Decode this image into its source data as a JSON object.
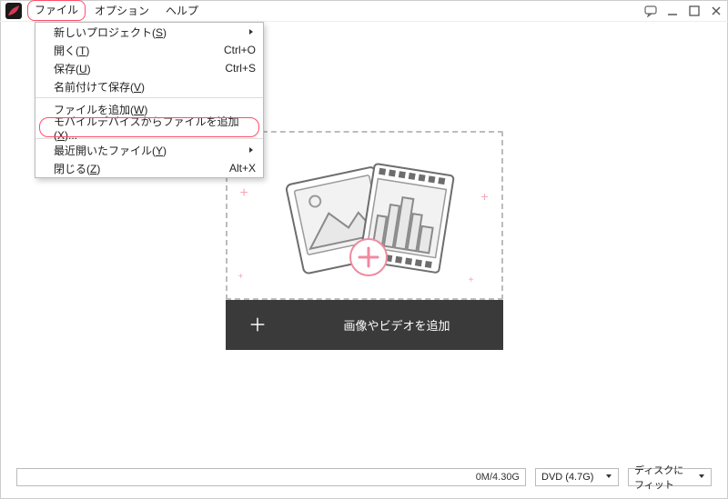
{
  "menu": {
    "file": "ファイル",
    "options": "オプション",
    "help": "ヘルプ"
  },
  "dropdown": {
    "new_project": {
      "label_pre": "新しいプロジェクト(",
      "accel": "S",
      "label_post": ")"
    },
    "open": {
      "label_pre": "開く(",
      "accel": "T",
      "label_post": ")",
      "shortcut": "Ctrl+O"
    },
    "save": {
      "label_pre": "保存(",
      "accel": "U",
      "label_post": ")",
      "shortcut": "Ctrl+S"
    },
    "save_as": {
      "label_pre": "名前付けて保存(",
      "accel": "V",
      "label_post": ")"
    },
    "add_file": {
      "label_pre": "ファイルを追加(",
      "accel": "W",
      "label_post": ")"
    },
    "add_mobile": {
      "label_pre": "モバイルデバイスからファイルを追加(",
      "accel": "X",
      "label_post": ")..."
    },
    "recent": {
      "label_pre": "最近開いたファイル(",
      "accel": "Y",
      "label_post": ")"
    },
    "close": {
      "label_pre": "閉じる(",
      "accel": "Z",
      "label_post": ")",
      "shortcut": "Alt+X"
    }
  },
  "dropzone": {
    "add_media_label": "画像やビデオを追加"
  },
  "footer": {
    "capacity": "0M/4.30G",
    "media_type": "DVD (4.7G)",
    "fit_mode": "ディスクにフィット"
  }
}
